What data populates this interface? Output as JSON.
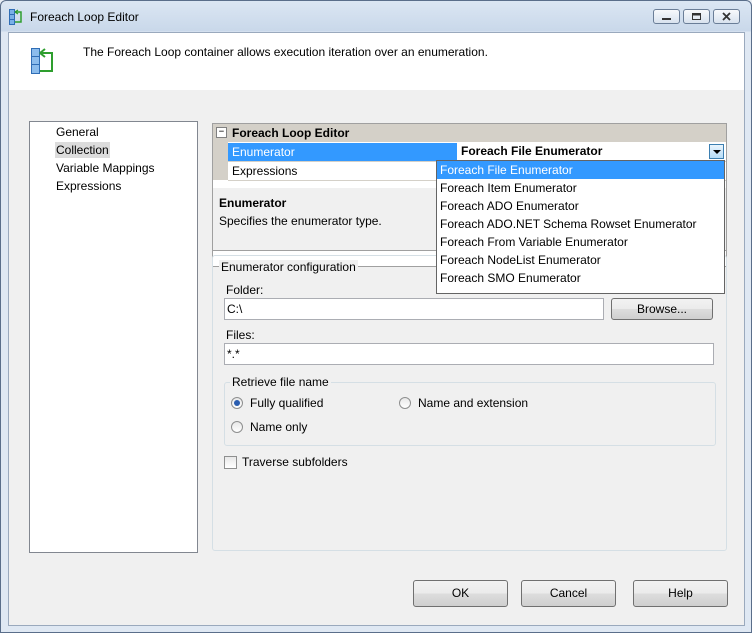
{
  "window": {
    "title": "Foreach Loop Editor"
  },
  "header": {
    "description": "The Foreach Loop container allows execution iteration over an enumeration."
  },
  "nav": {
    "items": [
      "General",
      "Collection",
      "Variable Mappings",
      "Expressions"
    ],
    "selected": "Collection"
  },
  "property_grid": {
    "category": "Foreach Loop Editor",
    "rows": [
      {
        "name": "Enumerator",
        "value": "Foreach File Enumerator"
      },
      {
        "name": "Expressions",
        "value": ""
      }
    ]
  },
  "help": {
    "title": "Enumerator",
    "description": "Specifies the enumerator type."
  },
  "dropdown": {
    "options": [
      "Foreach File Enumerator",
      "Foreach Item Enumerator",
      "Foreach ADO Enumerator",
      "Foreach ADO.NET Schema Rowset Enumerator",
      "Foreach From Variable Enumerator",
      "Foreach NodeList Enumerator",
      "Foreach SMO Enumerator"
    ],
    "highlighted": "Foreach File Enumerator"
  },
  "config": {
    "group_label": "Enumerator configuration",
    "folder_label": "Folder:",
    "folder_value": "C:\\",
    "browse_label": "Browse...",
    "files_label": "Files:",
    "files_value": "*.*",
    "retrieve_group_label": "Retrieve file name",
    "options": {
      "fully_qualified": "Fully qualified",
      "name_and_extension": "Name and extension",
      "name_only": "Name only"
    },
    "selected_option": "Fully qualified",
    "traverse_label": "Traverse subfolders",
    "traverse_checked": false
  },
  "buttons": {
    "ok": "OK",
    "cancel": "Cancel",
    "help": "Help"
  },
  "colors": {
    "selection": "#3399ff",
    "accent_green": "#2e9e2e",
    "icon_blue": "#4a90d9"
  }
}
